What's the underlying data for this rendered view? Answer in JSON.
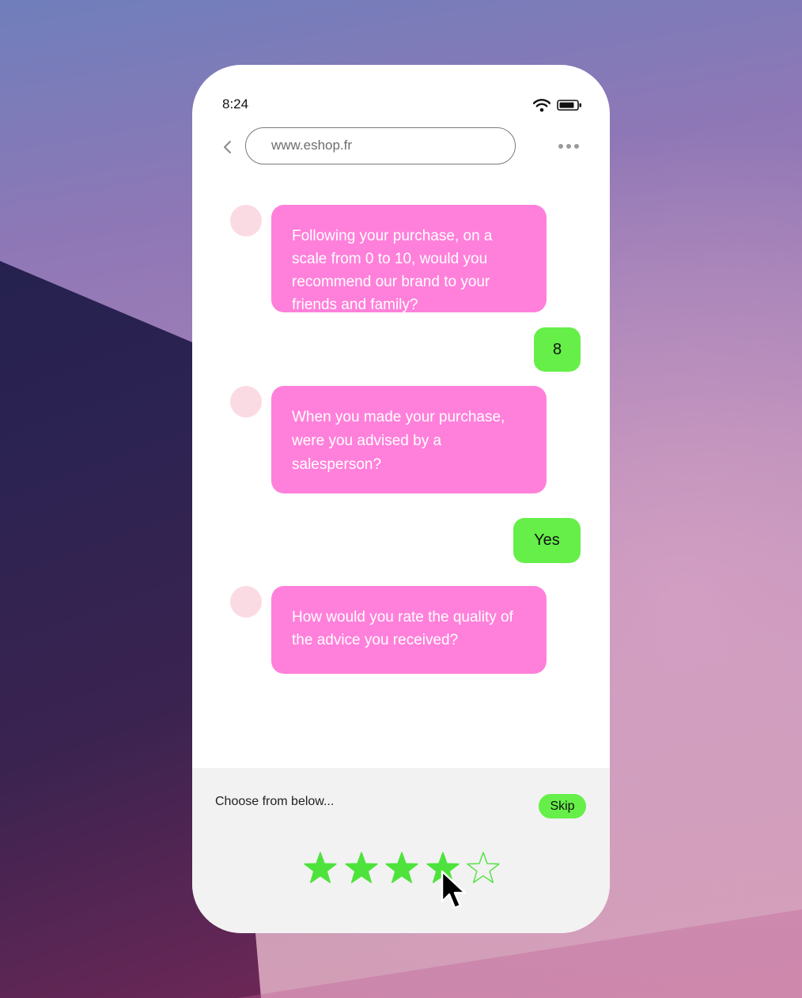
{
  "status_bar": {
    "time": "8:24",
    "wifi_icon": "wifi-icon",
    "battery_icon": "battery-icon"
  },
  "browser": {
    "back_icon": "chevron-left-icon",
    "url": "www.eshop.fr",
    "menu_icon": "more-horizontal-icon"
  },
  "chat": {
    "messages": [
      {
        "from": "bot",
        "text": "Following your purchase, on a scale from 0 to 10, would you recommend our brand to your friends and family?"
      },
      {
        "from": "user",
        "text": "8"
      },
      {
        "from": "bot",
        "text": "When you made your purchase, were you advised by a salesperson?"
      },
      {
        "from": "user",
        "text": "Yes"
      },
      {
        "from": "bot",
        "text": "How would you rate the quality of the advice you received?"
      }
    ]
  },
  "answer_panel": {
    "prompt": "Choose from below...",
    "skip_label": "Skip",
    "rating": {
      "max": 5,
      "selected": 4,
      "icon": "star-icon"
    }
  },
  "colors": {
    "bot_bubble": "#ff80da",
    "user_bubble": "#65ef48",
    "avatar": "#fbdbe3",
    "star": "#4ee33c"
  }
}
